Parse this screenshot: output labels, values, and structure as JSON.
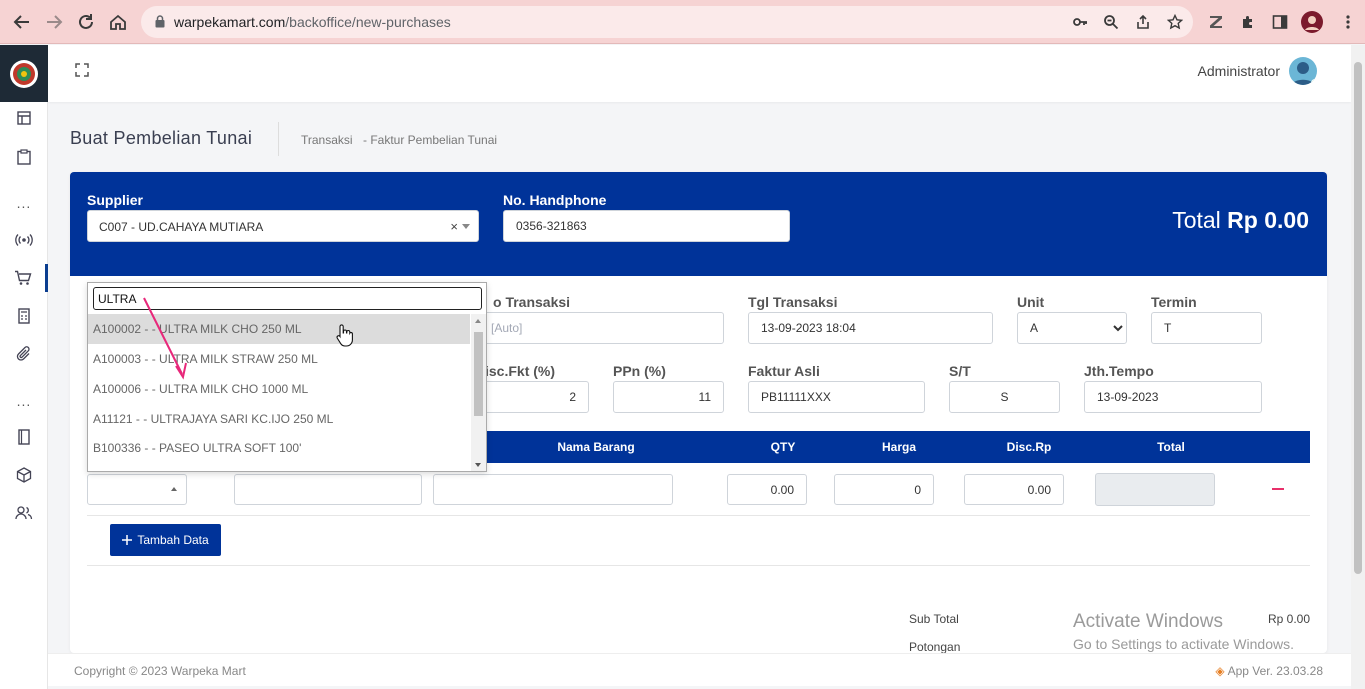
{
  "browser": {
    "url_host": "warpekamart.com",
    "url_path": "/backoffice/new-purchases"
  },
  "header": {
    "admin_name": "Administrator"
  },
  "page": {
    "title": "Buat Pembelian Tunai",
    "breadcrumb": [
      "Transaksi",
      "- Faktur Pembelian Tunai"
    ]
  },
  "form": {
    "supplier_label": "Supplier",
    "supplier_value": "C007 - UD.CAHAYA MUTIARA",
    "clear_symbol": "×",
    "phone_label": "No. Handphone",
    "phone_value": "0356-321863",
    "total_label": "Total",
    "total_value": "Rp 0.00",
    "no_transaksi_label": "o Transaksi",
    "no_transaksi_placeholder": "[Auto]",
    "tgl_label": "Tgl Transaksi",
    "tgl_value": "13-09-2023 18:04",
    "unit_label": "Unit",
    "unit_value": "A",
    "termin_label": "Termin",
    "termin_value": "T",
    "disc_label": "isc.Fkt (%)",
    "disc_value": "2",
    "ppn_label": "PPn (%)",
    "ppn_value": "11",
    "faktur_label": "Faktur Asli",
    "faktur_value": "PB11111XXX",
    "st_label": "S/T",
    "st_value": "S",
    "tempo_label": "Jth.Tempo",
    "tempo_value": "13-09-2023"
  },
  "table": {
    "headers": {
      "nama": "Nama Barang",
      "qty": "QTY",
      "harga": "Harga",
      "disc": "Disc.Rp",
      "total": "Total"
    },
    "row": {
      "qty": "0.00",
      "harga": "0",
      "disc": "0.00"
    },
    "add_label": "Tambah Data"
  },
  "summary": {
    "subtotal_label": "Sub Total",
    "subtotal_value": "Rp 0.00",
    "potongan_label": "Potongan"
  },
  "dropdown": {
    "search_value": "ULTRA",
    "items": [
      "A100002 - - ULTRA MILK CHO 250 ML",
      "A100003 - - ULTRA MILK STRAW 250 ML",
      "A100006 - - ULTRA MILK CHO 1000 ML",
      "A11121 - - ULTRAJAYA SARI KC.IJO 250 ML",
      "B100336 - - PASEO ULTRA SOFT 100'"
    ]
  },
  "watermark": {
    "title": "Activate Windows",
    "subtitle": "Go to Settings to activate Windows."
  },
  "footer": {
    "copyright": "Copyright © 2023 Warpeka Mart",
    "version": "App Ver. 23.03.28"
  },
  "colors": {
    "primary": "#003399",
    "danger": "#e8306a",
    "annotation": "#e8287a"
  }
}
